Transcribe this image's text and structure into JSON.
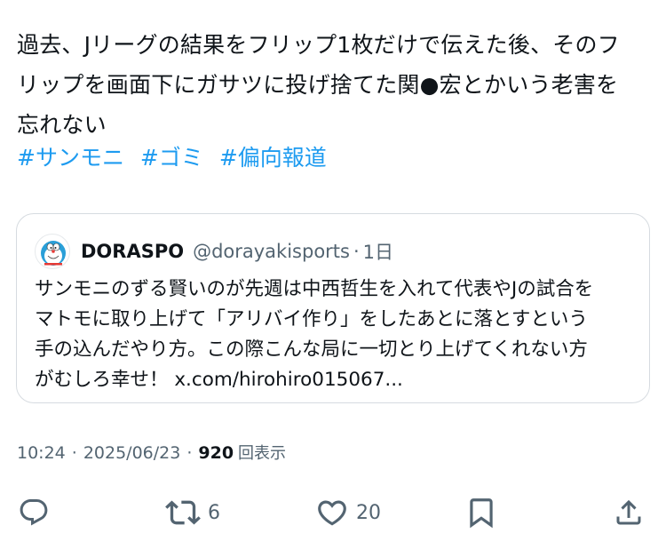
{
  "tweet": {
    "text_lines": [
      "過去、Jリーグの結果をフリップ1枚だけで伝えた後、そのフ",
      "リップを画面下にガサツに投げ捨てた関●宏とかいう老害を",
      "忘れない"
    ],
    "hashtags": [
      "#サンモニ",
      "#ゴミ",
      "#偏向報道"
    ]
  },
  "quote": {
    "name": "DORASPO",
    "handle": "@dorayakisports",
    "separator": "·",
    "time": "1日",
    "avatar_icon": "doraemon-avatar",
    "body_lines": [
      "サンモニのずる賢いのが先週は中西哲生を入れて代表やJの試合を",
      "マトモに取り上げて「アリバイ作り」をしたあとに落とすという",
      "手の込んだやり方。この際こんな局に一切とり上げてくれない方",
      "がむしろ幸せ！ x.com/hirohiro015067..."
    ]
  },
  "meta": {
    "time": "10:24",
    "separator": "·",
    "date": "2025/06/23",
    "views_count": "920",
    "views_label": "回表示"
  },
  "actions": {
    "reply_icon": "reply-icon",
    "retweet_icon": "retweet-icon",
    "retweet_count": "6",
    "like_icon": "heart-icon",
    "like_count": "20",
    "bookmark_icon": "bookmark-icon",
    "share_icon": "share-icon"
  },
  "colors": {
    "text": "#0f1419",
    "muted": "#536471",
    "link": "#1d9bf0",
    "border": "#d6dbe0"
  }
}
